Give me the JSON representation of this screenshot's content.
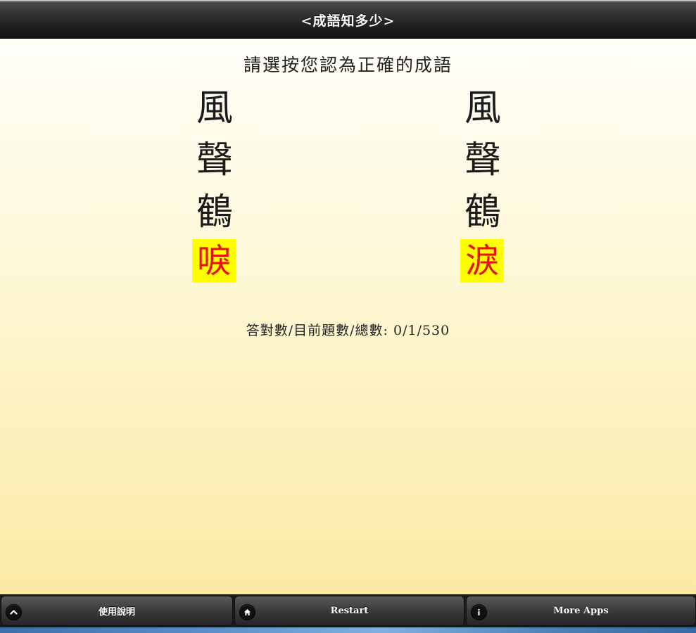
{
  "header": {
    "title": "<成語知多少>"
  },
  "main": {
    "instruction": "請選按您認為正確的成語",
    "options": [
      {
        "chars": [
          "風",
          "聲",
          "鶴",
          "唳"
        ]
      },
      {
        "chars": [
          "風",
          "聲",
          "鶴",
          "淚"
        ]
      }
    ],
    "score_label": "答對數/目前題數/總數: 0/1/530"
  },
  "footer": {
    "buttons": [
      {
        "label": "使用說明",
        "icon": "chevron-up-icon"
      },
      {
        "label": "Restart",
        "icon": "home-icon"
      },
      {
        "label": "More Apps",
        "icon": "info-icon"
      }
    ]
  },
  "colors": {
    "highlight_bg": "#ffff00",
    "highlight_text": "#e8110f",
    "header_bg": "#2c2c2c",
    "content_top": "#fffef9",
    "content_bottom": "#fbeaa4"
  }
}
